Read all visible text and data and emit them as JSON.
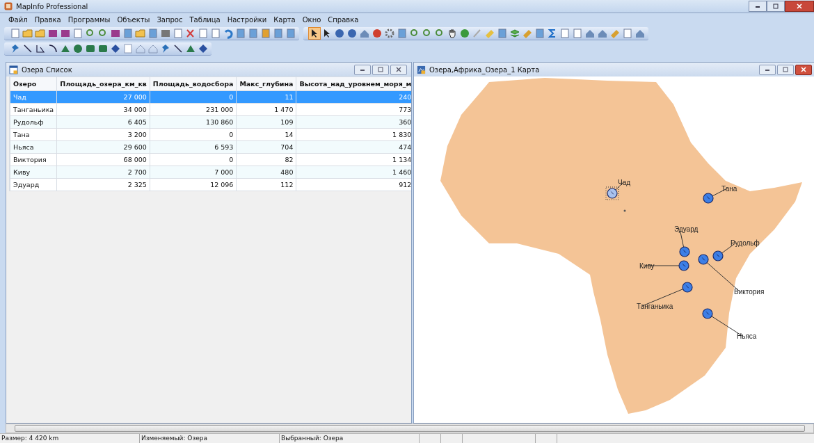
{
  "window": {
    "title": "MapInfo Professional"
  },
  "menu": [
    "Файл",
    "Правка",
    "Программы",
    "Объекты",
    "Запрос",
    "Таблица",
    "Настройки",
    "Карта",
    "Окно",
    "Справка"
  ],
  "browser": {
    "title": "Озера Список",
    "columns": [
      "Озеро",
      "Площадь_озера_км_кв",
      "Площадь_водосбора",
      "Макс_глубина",
      "Высота_над_уровнем_моря_м"
    ],
    "rows": [
      {
        "cells": [
          "Чад",
          "27 000",
          "0",
          "11",
          "240"
        ],
        "selected": true
      },
      {
        "cells": [
          "Танганьика",
          "34 000",
          "231 000",
          "1 470",
          "773"
        ],
        "selected": false
      },
      {
        "cells": [
          "Рудольф",
          "6 405",
          "130 860",
          "109",
          "360"
        ],
        "selected": false
      },
      {
        "cells": [
          "Тана",
          "3 200",
          "0",
          "14",
          "1 830"
        ],
        "selected": false
      },
      {
        "cells": [
          "Ньяса",
          "29 600",
          "6 593",
          "704",
          "474"
        ],
        "selected": false
      },
      {
        "cells": [
          "Виктория",
          "68 000",
          "0",
          "82",
          "1 134"
        ],
        "selected": false
      },
      {
        "cells": [
          "Киву",
          "2 700",
          "7 000",
          "480",
          "1 460"
        ],
        "selected": false
      },
      {
        "cells": [
          "Эдуард",
          "2 325",
          "12 096",
          "112",
          "912"
        ],
        "selected": false
      }
    ]
  },
  "map": {
    "title": "Озера,Африка_Озера_1 Карта",
    "lakes": [
      {
        "label": "Чад",
        "selected": true
      },
      {
        "label": "Тана",
        "selected": false
      },
      {
        "label": "Эдуард",
        "selected": false
      },
      {
        "label": "Рудольф",
        "selected": false
      },
      {
        "label": "Киву",
        "selected": false
      },
      {
        "label": "Виктория",
        "selected": false
      },
      {
        "label": "Танганьика",
        "selected": false
      },
      {
        "label": "Ньяса",
        "selected": false
      }
    ]
  },
  "status_bar": [
    "Размер: 4 420 km",
    "Изменяемый: Озера",
    "Выбранный: Озера"
  ]
}
